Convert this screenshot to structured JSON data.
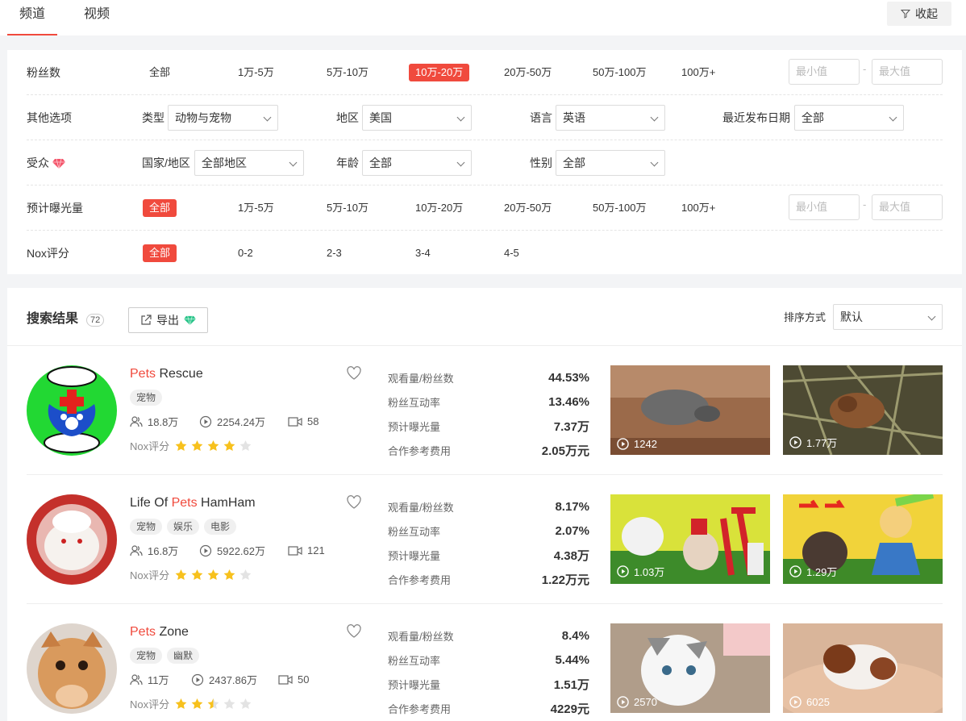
{
  "tabs": [
    {
      "label": "频道",
      "active": true
    },
    {
      "label": "视频",
      "active": false
    }
  ],
  "collapse_label": "收起",
  "filters": {
    "fans": {
      "label": "粉丝数",
      "options": [
        "全部",
        "1万-5万",
        "5万-10万",
        "10万-20万",
        "20万-50万",
        "50万-100万",
        "100万+"
      ],
      "selected": "10万-20万",
      "min_placeholder": "最小值",
      "max_placeholder": "最大值"
    },
    "other": {
      "label": "其他选项",
      "type_label": "类型",
      "type_value": "动物与宠物",
      "region_label": "地区",
      "region_value": "美国",
      "language_label": "语言",
      "language_value": "英语",
      "recent_label": "最近发布日期",
      "recent_value": "全部"
    },
    "audience": {
      "label": "受众",
      "country_label": "国家/地区",
      "country_value": "全部地区",
      "age_label": "年龄",
      "age_value": "全部",
      "gender_label": "性别",
      "gender_value": "全部"
    },
    "exposure": {
      "label": "预计曝光量",
      "options": [
        "全部",
        "1万-5万",
        "5万-10万",
        "10万-20万",
        "20万-50万",
        "50万-100万",
        "100万+"
      ],
      "selected": "全部",
      "min_placeholder": "最小值",
      "max_placeholder": "最大值"
    },
    "nox": {
      "label": "Nox评分",
      "options": [
        "全部",
        "0-2",
        "2-3",
        "3-4",
        "4-5"
      ],
      "selected": "全部"
    }
  },
  "results": {
    "title": "搜索结果",
    "count": "72",
    "export_label": "导出",
    "sort_label": "排序方式",
    "sort_value": "默认",
    "metric_labels": [
      "观看量/粉丝数",
      "粉丝互动率",
      "预计曝光量",
      "合作参考费用"
    ],
    "nox_label": "Nox评分",
    "channels": [
      {
        "name_hl": "Pets",
        "name_rest": " Rescue",
        "name_pre": "",
        "tags": [
          "宠物"
        ],
        "subscribers": "18.8万",
        "views": "2254.24万",
        "videos": "58",
        "rating": 4,
        "metrics": [
          "44.53%",
          "13.46%",
          "7.37万",
          "2.05万元"
        ],
        "thumbs": [
          "1242",
          "1.77万"
        ]
      },
      {
        "name_pre": "Life Of ",
        "name_hl": "Pets",
        "name_rest": " HamHam",
        "tags": [
          "宠物",
          "娱乐",
          "电影"
        ],
        "subscribers": "16.8万",
        "views": "5922.62万",
        "videos": "121",
        "rating": 4,
        "metrics": [
          "8.17%",
          "2.07%",
          "4.38万",
          "1.22万元"
        ],
        "thumbs": [
          "1.03万",
          "1.29万"
        ]
      },
      {
        "name_pre": "",
        "name_hl": "Pets",
        "name_rest": " Zone",
        "tags": [
          "宠物",
          "幽默"
        ],
        "subscribers": "11万",
        "views": "2437.86万",
        "videos": "50",
        "rating": 2.5,
        "metrics": [
          "8.4%",
          "5.44%",
          "1.51万",
          "4229元"
        ],
        "thumbs": [
          "2570",
          "6025"
        ]
      }
    ]
  },
  "colors": {
    "accent": "#f04a3d",
    "star": "#f7c11d",
    "star_empty": "#e3e3e3",
    "gem": "#2bc48a"
  }
}
